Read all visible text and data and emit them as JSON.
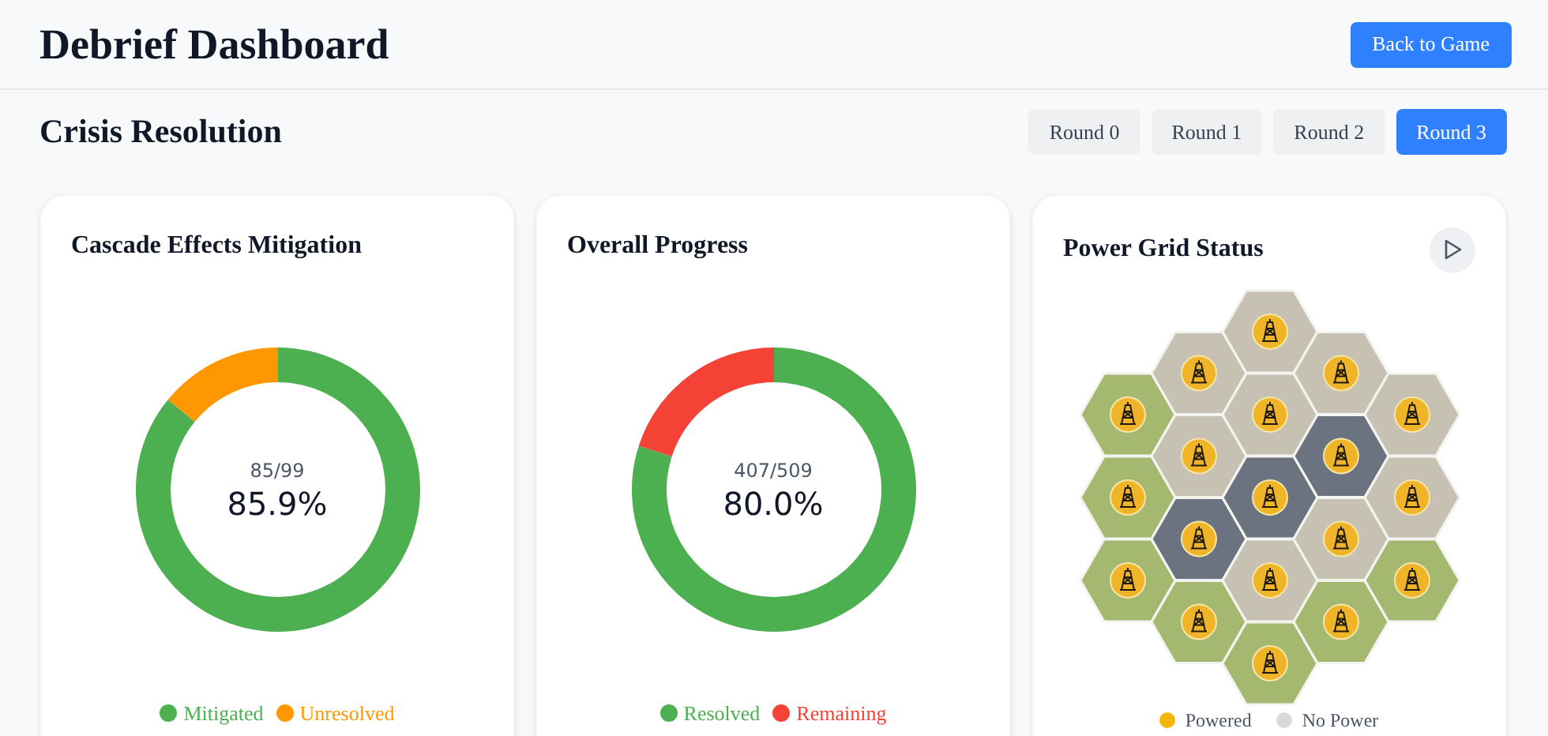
{
  "header": {
    "title": "Debrief Dashboard",
    "back_button": "Back to Game"
  },
  "section": {
    "title": "Crisis Resolution"
  },
  "rounds": [
    {
      "label": "Round 0",
      "selected": false
    },
    {
      "label": "Round 1",
      "selected": false
    },
    {
      "label": "Round 2",
      "selected": false
    },
    {
      "label": "Round 3",
      "selected": true
    }
  ],
  "cards": [
    {
      "title": "Cascade Effects Mitigation",
      "count": "85/99",
      "percent": "85.9%",
      "chart_data": {
        "type": "donut",
        "categories": [
          "Mitigated",
          "Unresolved"
        ],
        "values": [
          85.9,
          14.1
        ],
        "legend": "bottom"
      },
      "legend": [
        {
          "color": "#4caf50"
        },
        {
          "color": "#ff9800"
        }
      ]
    },
    {
      "title": "Overall Progress",
      "count": "407/509",
      "percent": "80.0%",
      "chart_data": {
        "type": "donut",
        "categories": [
          "Resolved",
          "Remaining"
        ],
        "values": [
          80.0,
          20.0
        ],
        "legend": "bottom"
      },
      "legend": [
        {
          "color": "#4caf50"
        },
        {
          "color": "#f44336"
        }
      ]
    }
  ],
  "grid": {
    "title": "Power Grid Status",
    "columns": [
      [
        {
          "color": "#a4b870",
          "powered": true
        },
        {
          "color": "#a4b870",
          "powered": true
        },
        {
          "color": "#a4b870",
          "powered": true
        }
      ],
      [
        {
          "color": "#c6c1b2",
          "powered": true
        },
        {
          "color": "#c6c1b2",
          "powered": true
        },
        {
          "color": "#6b7280",
          "powered": true
        },
        {
          "color": "#a4b870",
          "powered": true
        }
      ],
      [
        {
          "color": "#c6c1b2",
          "powered": true
        },
        {
          "color": "#c6c1b2",
          "powered": true
        },
        {
          "color": "#6b7280",
          "powered": true
        },
        {
          "color": "#c6c1b2",
          "powered": true
        },
        {
          "color": "#a4b870",
          "powered": true
        }
      ],
      [
        {
          "color": "#c6c1b2",
          "powered": true
        },
        {
          "color": "#6b7280",
          "powered": true
        },
        {
          "color": "#c6c1b2",
          "powered": true
        },
        {
          "color": "#a4b870",
          "powered": true
        }
      ],
      [
        {
          "color": "#c6c1b2",
          "powered": true
        },
        {
          "color": "#c6c1b2",
          "powered": true
        },
        {
          "color": "#a4b870",
          "powered": true
        }
      ]
    ],
    "legend": [
      {
        "label": "Powered",
        "color": "#f5b50a"
      },
      {
        "label": "No Power",
        "color": "#d9d9d9"
      }
    ]
  }
}
